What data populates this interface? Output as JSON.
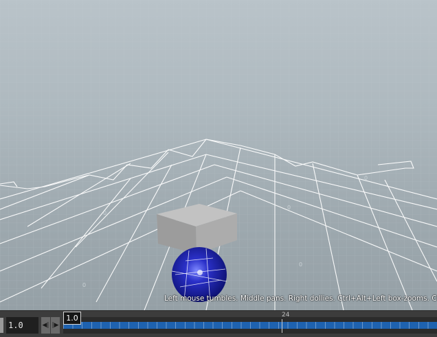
{
  "viewport": {
    "hint_text": "Left mouse tumbles. Middle pans. Right dollies. Ctrl+Alt+Left box-zooms. Ctrl+Rig"
  },
  "timebar": {
    "frame_value": "1.0",
    "current_frame_label": "1.0",
    "frame_tick_label": "24",
    "step_back_icon": "step-back-icon",
    "step_forward_icon": "step-forward-icon",
    "timeline_color": "#1e62b0"
  },
  "scene": {
    "box_color": "#a8a8a8",
    "sphere_color": "#1820a0",
    "grid_color": "#ffffff"
  }
}
